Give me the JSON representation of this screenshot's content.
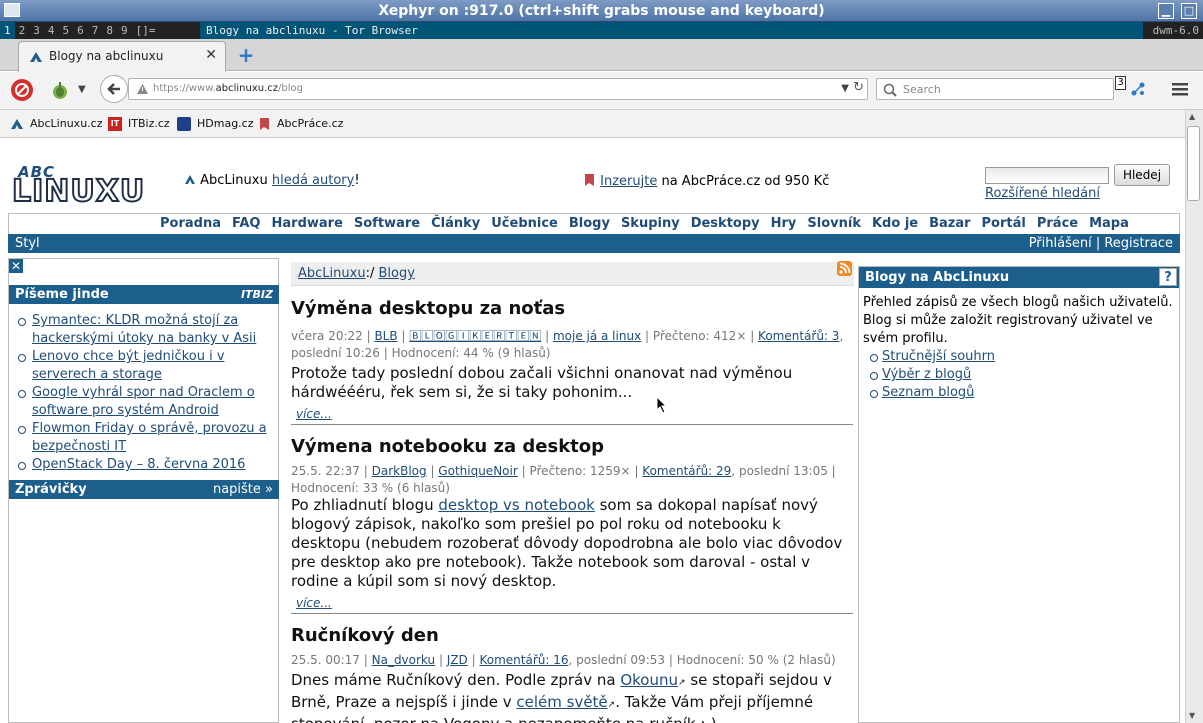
{
  "xephyr": {
    "title": "Xephyr on :917.0 (ctrl+shift grabs mouse and keyboard)"
  },
  "dwm": {
    "tags": [
      "1",
      "2",
      "3",
      "4",
      "5",
      "6",
      "7",
      "8",
      "9"
    ],
    "layout": "[]=",
    "window_title": "Blogy na abclinuxu - Tor Browser",
    "status": "dwm-6.0"
  },
  "browser": {
    "tab_title": "Blogy na abclinuxu",
    "url_prefix": "https://www.",
    "url_domain": "abclinuxu.cz",
    "url_path": "/blog",
    "search_placeholder": "Search",
    "badge": "3",
    "bookmarks": [
      "AbcLinuxu.cz",
      "ITBiz.cz",
      "HDmag.cz",
      "AbcPráce.cz"
    ]
  },
  "header": {
    "logo_line1": "ABC",
    "logo_line2": "LINUXU",
    "ad1_prefix": "AbcLinuxu ",
    "ad1_link": "hledá autory",
    "ad1_suffix": "!",
    "ad2_link": "Inzerujte",
    "ad2_suffix": " na AbcPráce.cz od 950 Kč",
    "search_button": "Hledej",
    "advanced_search": "Rozšířené hledání"
  },
  "menu": [
    "Poradna",
    "FAQ",
    "Hardware",
    "Software",
    "Články",
    "Učebnice",
    "Blogy",
    "Skupiny",
    "Desktopy",
    "Hry",
    "Slovník",
    "Kdo je",
    "Bazar",
    "Portál",
    "Práce",
    "Mapa"
  ],
  "stylbar": {
    "left": "Styl",
    "login": "Přihlášení",
    "sep": " | ",
    "register": "Registrace"
  },
  "left": {
    "close": "✕",
    "pisemejinde": {
      "title": "Píšeme jinde",
      "badge": "ITBIZ",
      "items": [
        "Symantec: KLDR možná stojí za hackerskými útoky na banky v Asii",
        "Lenovo chce být jedničkou i v serverech a storage",
        "Google vyhrál spor nad Oraclem o software pro systém Android",
        "Flowmon Friday o správě, provozu a bezpečnosti IT",
        "OpenStack Day – 8. června 2016"
      ]
    },
    "zpravicky": {
      "title": "Zprávičky",
      "link": "napište »"
    }
  },
  "crumb": {
    "root": "AbcLinuxu",
    "sep": ":/ ",
    "current": "Blogy"
  },
  "posts": [
    {
      "title": "Výměna desktopu za noťas",
      "date": "včera 20:22",
      "author": "BLB",
      "blog": "🄱🄻🄾🄶🄸🄺🄴🅁🅃🄴🄽",
      "category": "moje já a linux",
      "reads": "Přečteno: 412×",
      "comments": "Komentářů: 3",
      "last": "poslední 10:26",
      "rating": "Hodnocení: 44 % (9 hlasů)",
      "text": "Protože tady poslední dobou začali všichni onanovat nad výměnou hárdwéééru, řek sem si, že si taky pohonim...",
      "more": "více..."
    },
    {
      "title": "Výmena notebooku za desktop",
      "date": "25.5. 22:37",
      "author": "DarkBlog",
      "blog": "GothiqueNoir",
      "reads": "Přečteno: 1259×",
      "comments": "Komentářů: 29",
      "last": "poslední 13:05",
      "rating": "Hodnocení: 33 % (6 hlasů)",
      "text_a": "Po zhliadnutí blogu ",
      "text_link": "desktop vs notebook",
      "text_b": " som sa dokopal napísať nový blogový zápisok, nakoľko som prešiel po pol roku od notebooku k desktopu (nebudem rozoberať dôvody dopodrobna ale bolo viac dôvodov pre desktop ako pre notebook). Takže notebook som daroval - ostal v rodine a kúpil som si nový desktop.",
      "more": "více..."
    },
    {
      "title": "Ručníkový den",
      "date": "25.5. 00:17",
      "author": "Na_dvorku",
      "blog": "JZD",
      "comments": "Komentářů: 16",
      "last": "poslední 09:53",
      "rating": "Hodnocení: 50 % (2 hlasů)",
      "text_a": "Dnes máme Ručníkový den. Podle zpráv na ",
      "text_link1": "Okounu",
      "text_b": " se stopaři sejdou v Brně, Praze a nejspíš i jinde v ",
      "text_link2": "celém světě",
      "text_c": ". Takže Vám přeji příjemné stopování, pozor na Vogony a nezapomeňte na ručník :-)"
    }
  ],
  "right": {
    "title": "Blogy na AbcLinuxu",
    "help": "?",
    "desc": "Přehled zápisů ze všech blogů našich uživatelů. Blog si může založit registrovaný uživatel ve svém profilu.",
    "links": [
      "Stručnější souhrn",
      "Výběr z blogů",
      "Seznam blogů"
    ]
  }
}
